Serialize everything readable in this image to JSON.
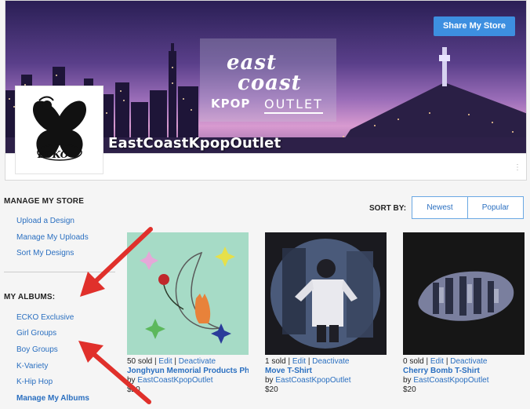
{
  "header": {
    "share_label": "Share My Store",
    "store_name": "EastCoastKpopOutlet",
    "brand_line1": "east",
    "brand_line2": "coast",
    "brand_kpop": "KPOP",
    "brand_outlet": "OUTLET",
    "avatar_text": "ECKO"
  },
  "sidebar": {
    "manage_heading": "MANAGE MY STORE",
    "manage_links": [
      "Upload a Design",
      "Manage My Uploads",
      "Sort My Designs"
    ],
    "albums_heading": "MY ALBUMS:",
    "album_links": [
      "ECKO Exclusive",
      "Girl Groups",
      "Boy Groups",
      "K-Variety",
      "K-Hip Hop"
    ],
    "manage_albums_label": "Manage My Albums"
  },
  "sort": {
    "label": "SORT BY:",
    "options": [
      "Newest",
      "Popular"
    ]
  },
  "products": [
    {
      "sold": "50 sold",
      "edit": "Edit",
      "deactivate": "Deactivate",
      "title": "Jonghyun Memorial Products Ph...",
      "by": "by",
      "seller": "EastCoastKpopOutlet",
      "price": "$20"
    },
    {
      "sold": "1 sold",
      "edit": "Edit",
      "deactivate": "Deactivate",
      "title": "Move T-Shirt",
      "by": "by",
      "seller": "EastCoastKpopOutlet",
      "price": "$20"
    },
    {
      "sold": "0 sold",
      "edit": "Edit",
      "deactivate": "Deactivate",
      "title": "Cherry Bomb T-Shirt",
      "by": "by",
      "seller": "EastCoastKpopOutlet",
      "price": "$20"
    }
  ],
  "colors": {
    "accent": "#3d8fe0",
    "link": "#2a6fc0",
    "arrow": "#e0302b"
  }
}
